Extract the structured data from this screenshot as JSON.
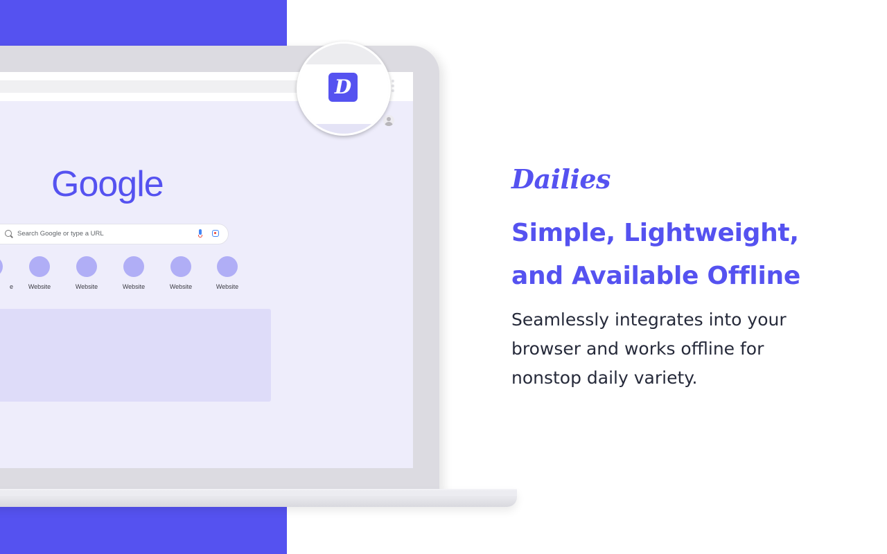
{
  "colors": {
    "accent": "#5552f0",
    "screen_background": "#eeedfb",
    "shortcut_circle": "#b0aef6",
    "content_panel": "#dedcf9",
    "body_text": "#262a3a"
  },
  "browser": {
    "logo_text": "Google",
    "search": {
      "placeholder": "Search Google or type a URL"
    },
    "shortcuts": [
      {
        "label": "e"
      },
      {
        "label": "Website"
      },
      {
        "label": "Website"
      },
      {
        "label": "Website"
      },
      {
        "label": "Website"
      },
      {
        "label": "Website"
      }
    ],
    "extension_icon_letter": "D"
  },
  "promo": {
    "brand": "Dailies",
    "headline_line1": "Simple, Lightweight,",
    "headline_line2": "and Available Offline",
    "body_line1": "Seamlessly integrates into your",
    "body_line2": "browser and works offline for",
    "body_line3": "nonstop daily variety."
  }
}
